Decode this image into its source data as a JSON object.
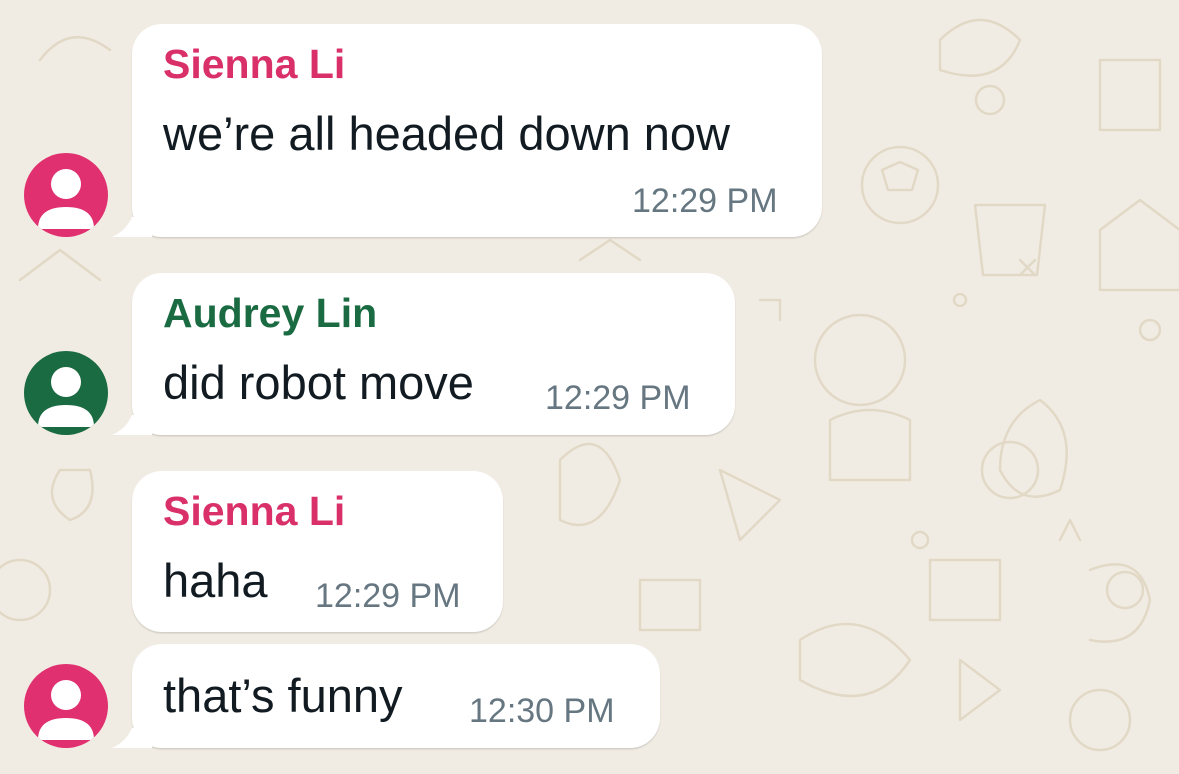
{
  "colors": {
    "background": "#f1ece3",
    "bubble": "#ffffff",
    "pink": "#e0306f",
    "green": "#1b6b42",
    "sienna_name": "#d93069",
    "audrey_name": "#1b6b42",
    "timestamp": "#667781",
    "message_text": "#111b21"
  },
  "messages": [
    {
      "sender": "Sienna Li",
      "avatar_icon": "person-icon",
      "avatar_color": "#e0306f",
      "text": "we’re all headed down now",
      "time": "12:29 PM"
    },
    {
      "sender": "Audrey Lin",
      "avatar_icon": "person-icon",
      "avatar_color": "#1b6b42",
      "text": "did robot move",
      "time": "12:29 PM"
    },
    {
      "sender": "Sienna Li",
      "text": "haha",
      "time": "12:29 PM"
    },
    {
      "avatar_icon": "person-icon",
      "avatar_color": "#e0306f",
      "text": "that’s funny",
      "time": "12:30 PM"
    }
  ]
}
